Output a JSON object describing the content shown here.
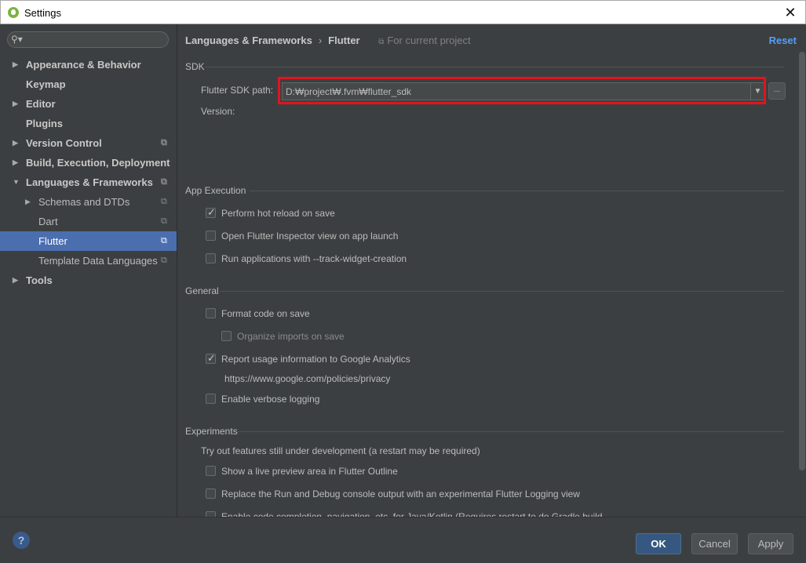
{
  "window": {
    "title": "Settings",
    "close_glyph": "✕"
  },
  "sidebar": {
    "search_placeholder": "",
    "items": [
      {
        "label": "Appearance & Behavior",
        "arrow": "▶"
      },
      {
        "label": "Keymap"
      },
      {
        "label": "Editor",
        "arrow": "▶"
      },
      {
        "label": "Plugins"
      },
      {
        "label": "Version Control",
        "arrow": "▶"
      },
      {
        "label": "Build, Execution, Deployment",
        "arrow": "▶"
      },
      {
        "label": "Languages & Frameworks",
        "arrow": "▼"
      },
      {
        "label": "Schemas and DTDs",
        "arrow": "▶"
      },
      {
        "label": "Dart"
      },
      {
        "label": "Flutter",
        "selected": true
      },
      {
        "label": "Template Data Languages"
      },
      {
        "label": "Tools",
        "arrow": "▶"
      }
    ]
  },
  "breadcrumb": {
    "parent": "Languages & Frameworks",
    "current": "Flutter",
    "scope": "For current project",
    "separator": "›"
  },
  "reset_label": "Reset",
  "sdk": {
    "group_title": "SDK",
    "path_label": "Flutter SDK path:",
    "path_value": "D:₩project₩.fvm₩flutter_sdk",
    "version_label": "Version:",
    "browse_label": "..."
  },
  "app_execution": {
    "group_title": "App Execution",
    "options": [
      {
        "label": "Perform hot reload on save",
        "checked": true
      },
      {
        "label": "Open Flutter Inspector view on app launch",
        "checked": false
      },
      {
        "label": "Run applications with --track-widget-creation",
        "checked": false
      }
    ]
  },
  "general": {
    "group_title": "General",
    "format_on_save": "Format code on save",
    "organize_imports": "Organize imports on save",
    "report_usage": "Report usage information to Google Analytics",
    "privacy_url": "https://www.google.com/policies/privacy",
    "verbose_logging": "Enable verbose logging"
  },
  "experiments": {
    "group_title": "Experiments",
    "description": "Try out features still under development (a restart may be required)",
    "options": [
      "Show a live preview area in Flutter Outline",
      "Replace the Run and Debug console output with an experimental Flutter Logging view",
      "Enable code completion, navigation, etc. for Java/Kotlin (Requires restart to do Gradle build"
    ]
  },
  "footer": {
    "help": "?",
    "ok": "OK",
    "cancel": "Cancel",
    "apply": "Apply"
  },
  "colors": {
    "accent": "#4b6eaf",
    "link": "#589df6",
    "highlight_border": "#e0141e"
  }
}
